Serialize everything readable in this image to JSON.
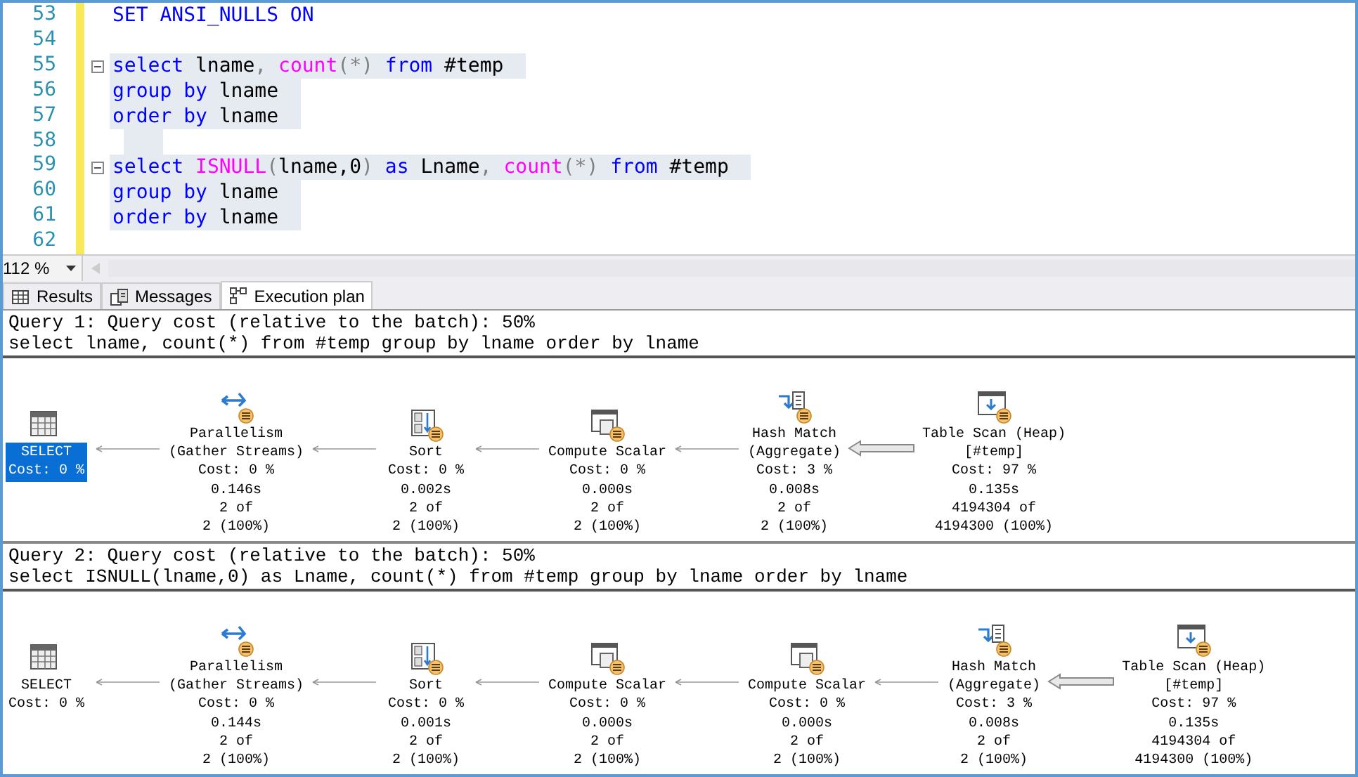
{
  "editor": {
    "lines": [
      {
        "number": "53",
        "highlighted": false,
        "fold": false,
        "tokens": [
          {
            "kind": "keyword",
            "text": "SET ANSI_NULLS ON"
          }
        ]
      },
      {
        "number": "54",
        "highlighted": false,
        "fold": false
      },
      {
        "number": "55",
        "highlighted": true,
        "fold": true,
        "tokens": [
          {
            "kind": "keyword",
            "text": "select"
          },
          {
            "kind": "plain",
            "text": " lname"
          },
          {
            "kind": "op",
            "text": ", "
          },
          {
            "kind": "function",
            "text": "count"
          },
          {
            "kind": "op",
            "text": "(*)"
          },
          {
            "kind": "keyword",
            "text": " from"
          },
          {
            "kind": "plain",
            "text": " #temp"
          }
        ]
      },
      {
        "number": "56",
        "highlighted": true,
        "fold": false,
        "tokens": [
          {
            "kind": "keyword",
            "text": "group by"
          },
          {
            "kind": "plain",
            "text": " lname"
          }
        ]
      },
      {
        "number": "57",
        "highlighted": true,
        "fold": false,
        "tokens": [
          {
            "kind": "keyword",
            "text": "order by"
          },
          {
            "kind": "plain",
            "text": " lname"
          }
        ]
      },
      {
        "number": "58",
        "highlighted": true,
        "fold": false
      },
      {
        "number": "59",
        "highlighted": true,
        "fold": true,
        "tokens": [
          {
            "kind": "keyword",
            "text": "select "
          },
          {
            "kind": "function",
            "text": "ISNULL"
          },
          {
            "kind": "op",
            "text": "("
          },
          {
            "kind": "plain",
            "text": "lname,0"
          },
          {
            "kind": "op",
            "text": ")"
          },
          {
            "kind": "keyword",
            "text": " as"
          },
          {
            "kind": "plain",
            "text": " Lname"
          },
          {
            "kind": "op",
            "text": ", "
          },
          {
            "kind": "function",
            "text": "count"
          },
          {
            "kind": "op",
            "text": "(*)"
          },
          {
            "kind": "keyword",
            "text": " from"
          },
          {
            "kind": "plain",
            "text": " #temp"
          }
        ]
      },
      {
        "number": "60",
        "highlighted": true,
        "fold": false,
        "tokens": [
          {
            "kind": "keyword",
            "text": "group by"
          },
          {
            "kind": "plain",
            "text": " lname"
          }
        ]
      },
      {
        "number": "61",
        "highlighted": true,
        "fold": false,
        "tokens": [
          {
            "kind": "keyword",
            "text": "order by"
          },
          {
            "kind": "plain",
            "text": " lname"
          }
        ]
      },
      {
        "number": "62",
        "highlighted": false,
        "fold": false
      }
    ]
  },
  "zoom": {
    "value": "112 %"
  },
  "tabs": [
    {
      "label": "Results",
      "selected": false
    },
    {
      "label": "Messages",
      "selected": false
    },
    {
      "label": "Execution plan",
      "selected": true
    }
  ],
  "queries": [
    {
      "header": "Query 1: Query cost (relative to the batch): 50%",
      "sql": "select lname, count(*) from #temp group by lname order by lname",
      "nodes": [
        {
          "kind": "select",
          "name": [
            "SELECT"
          ],
          "cost": "Cost: 0 %",
          "selected": true
        },
        {
          "kind": "parallelism",
          "name": [
            "Parallelism",
            "(Gather Streams)"
          ],
          "cost": "Cost: 0 %",
          "time": "0.146s",
          "rows": [
            "2 of",
            "2 (100%)"
          ],
          "selected": false
        },
        {
          "kind": "sort",
          "name": [
            "Sort"
          ],
          "cost": "Cost: 0 %",
          "time": "0.002s",
          "rows": [
            "2 of",
            "2 (100%)"
          ],
          "selected": false
        },
        {
          "kind": "compute",
          "name": [
            "Compute Scalar"
          ],
          "cost": "Cost: 0 %",
          "time": "0.000s",
          "rows": [
            "2 of",
            "2 (100%)"
          ],
          "selected": false
        },
        {
          "kind": "hash",
          "name": [
            "Hash Match",
            "(Aggregate)"
          ],
          "cost": "Cost: 3 %",
          "time": "0.008s",
          "rows": [
            "2 of",
            "2 (100%)"
          ],
          "selected": false
        },
        {
          "kind": "scan",
          "name": [
            "Table Scan (Heap)",
            "[#temp]"
          ],
          "cost": "Cost: 97 %",
          "time": "0.135s",
          "rows": [
            "4194304 of",
            "4194300 (100%)"
          ],
          "selected": false
        }
      ]
    },
    {
      "header": "Query 2: Query cost (relative to the batch): 50%",
      "sql": "select ISNULL(lname,0) as Lname, count(*) from #temp group by lname order by lname",
      "nodes": [
        {
          "kind": "select",
          "name": [
            "SELECT"
          ],
          "cost": "Cost: 0 %",
          "selected": false
        },
        {
          "kind": "parallelism",
          "name": [
            "Parallelism",
            "(Gather Streams)"
          ],
          "cost": "Cost: 0 %",
          "time": "0.144s",
          "rows": [
            "2 of",
            "2 (100%)"
          ],
          "selected": false
        },
        {
          "kind": "sort",
          "name": [
            "Sort"
          ],
          "cost": "Cost: 0 %",
          "time": "0.001s",
          "rows": [
            "2 of",
            "2 (100%)"
          ],
          "selected": false
        },
        {
          "kind": "compute",
          "name": [
            "Compute Scalar"
          ],
          "cost": "Cost: 0 %",
          "time": "0.000s",
          "rows": [
            "2 of",
            "2 (100%)"
          ],
          "selected": false
        },
        {
          "kind": "compute",
          "name": [
            "Compute Scalar"
          ],
          "cost": "Cost: 0 %",
          "time": "0.000s",
          "rows": [
            "2 of",
            "2 (100%)"
          ],
          "selected": false
        },
        {
          "kind": "hash",
          "name": [
            "Hash Match",
            "(Aggregate)"
          ],
          "cost": "Cost: 3 %",
          "time": "0.008s",
          "rows": [
            "2 of",
            "2 (100%)"
          ],
          "selected": false
        },
        {
          "kind": "scan",
          "name": [
            "Table Scan (Heap)",
            "[#temp]"
          ],
          "cost": "Cost: 97 %",
          "time": "0.135s",
          "rows": [
            "4194304 of",
            "4194300 (100%)"
          ],
          "selected": false
        }
      ]
    }
  ]
}
